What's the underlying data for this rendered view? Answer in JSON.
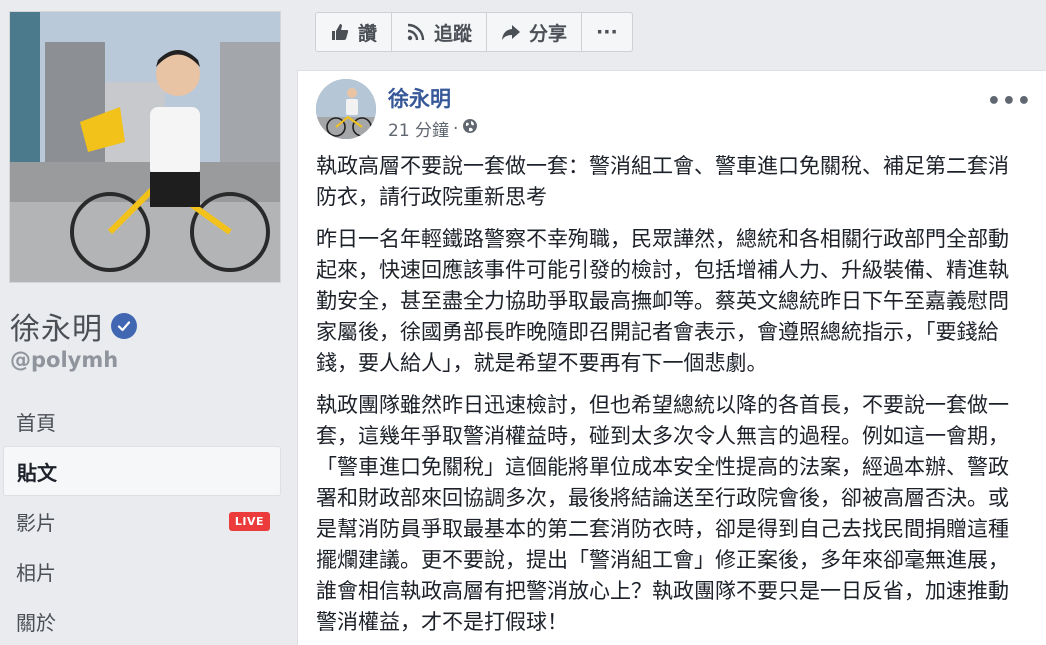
{
  "page": {
    "name": "徐永明",
    "handle": "@polymh",
    "verified": true
  },
  "nav": {
    "items": [
      {
        "label": "首頁",
        "active": false
      },
      {
        "label": "貼文",
        "active": true
      },
      {
        "label": "影片",
        "active": false,
        "badge": "LIVE"
      },
      {
        "label": "相片",
        "active": false
      },
      {
        "label": "關於",
        "active": false
      }
    ]
  },
  "actions": {
    "like": "讚",
    "follow": "追蹤",
    "share": "分享",
    "more": "···"
  },
  "post": {
    "author": "徐永明",
    "time": "21 分鐘",
    "privacy_icon": "globe-icon",
    "paragraphs": [
      "執政高層不要說一套做一套：警消組工會、警車進口免關稅、補足第二套消防衣，請行政院重新思考",
      "昨日一名年輕鐵路警察不幸殉職，民眾譁然，總統和各相關行政部門全部動起來，快速回應該事件可能引發的檢討，包括增補人力、升級裝備、精進執勤安全，甚至盡全力協助爭取最高撫卹等。蔡英文總統昨日下午至嘉義慰問家屬後，徐國勇部長昨晚隨即召開記者會表示，會遵照總統指示，「要錢給錢，要人給人」，就是希望不要再有下一個悲劇。",
      "執政團隊雖然昨日迅速檢討，但也希望總統以降的各首長，不要說一套做一套，這幾年爭取警消權益時，碰到太多次令人無言的過程。例如這一會期，「警車進口免關稅」這個能將單位成本安全性提高的法案，經過本辦、警政署和財政部來回協調多次，最後將結論送至行政院會後，卻被高層否決。或是幫消防員爭取最基本的第二套消防衣時，卻是得到自己去找民間捐贈這種擺爛建議。更不要說，提出「警消組工會」修正案後，多年來卻毫無進展，誰會相信執政高層有把警消放心上？執政團隊不要只是一日反省，加速推動警消權益，才不是打假球！"
    ]
  },
  "colors": {
    "link": "#365899",
    "live": "#eb3b3b",
    "verified": "#4267b2",
    "background": "#e9ebee"
  }
}
